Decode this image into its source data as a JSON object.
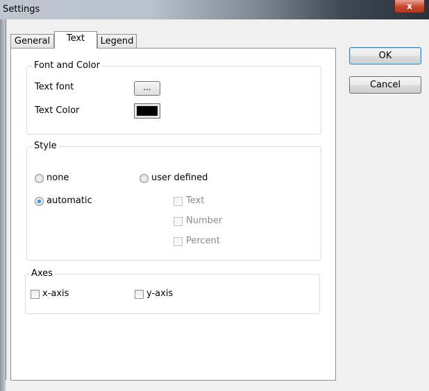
{
  "window": {
    "title": "Settings",
    "close_glyph": "x"
  },
  "tabs": [
    {
      "label": "General",
      "active": false
    },
    {
      "label": "Text",
      "active": true
    },
    {
      "label": "Legend",
      "active": false
    }
  ],
  "font_and_color": {
    "group_label": "Font and Color",
    "text_font_label": "Text font",
    "text_font_button": "...",
    "text_color_label": "Text Color",
    "text_color_value": "#000000"
  },
  "style": {
    "group_label": "Style",
    "none_label": "none",
    "automatic_label": "automatic",
    "user_defined_label": "user defined",
    "selected": "automatic",
    "options": [
      {
        "label": "Text",
        "checked": false,
        "enabled": false
      },
      {
        "label": "Number",
        "checked": false,
        "enabled": false
      },
      {
        "label": "Percent",
        "checked": false,
        "enabled": false
      }
    ]
  },
  "axes": {
    "group_label": "Axes",
    "x_axis_label": "x-axis",
    "y_axis_label": "y-axis",
    "x_checked": false,
    "y_checked": false
  },
  "buttons": {
    "ok": "OK",
    "cancel": "Cancel"
  }
}
